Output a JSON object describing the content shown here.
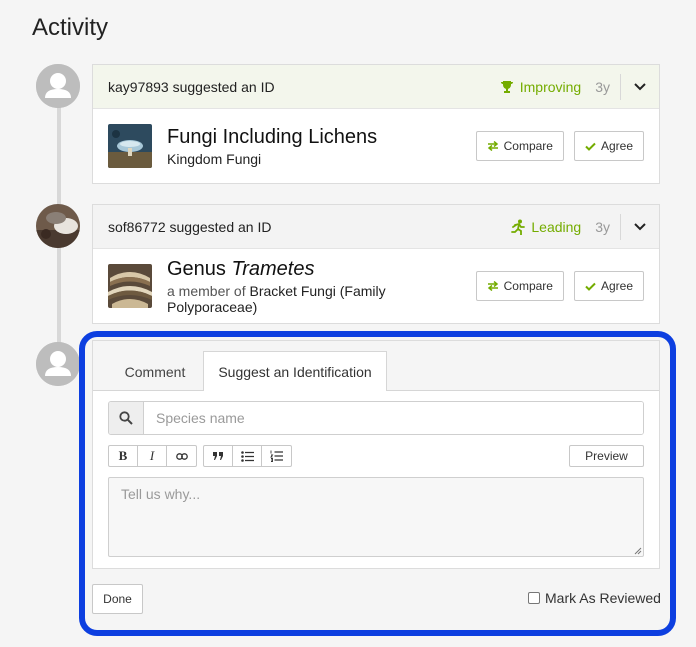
{
  "page": {
    "title": "Activity"
  },
  "identifications": [
    {
      "user": "kay97893",
      "action": " suggested an ID",
      "status": "Improving",
      "status_icon": "trophy-icon",
      "age": "3y",
      "taxon_name": "Fungi Including Lichens",
      "taxon_sub": "Kingdom Fungi",
      "compare_label": "Compare",
      "agree_label": "Agree"
    },
    {
      "user": "sof86772",
      "action": " suggested an ID",
      "status": "Leading",
      "status_icon": "leading-runner-icon",
      "age": "3y",
      "taxon_rank": "Genus ",
      "taxon_genus": "Trametes",
      "taxon_sub_prefix": "a member of ",
      "taxon_sub": "Bracket Fungi (Family Polyporaceae)",
      "compare_label": "Compare",
      "agree_label": "Agree"
    }
  ],
  "form": {
    "tabs": [
      "Comment",
      "Suggest an Identification"
    ],
    "active_tab": "Suggest an Identification",
    "search_placeholder": "Species name",
    "toolbar": {
      "bold": "B",
      "italic": "I"
    },
    "preview_label": "Preview",
    "textarea_placeholder": "Tell us why...",
    "done_label": "Done",
    "mark_reviewed_label": "Mark As Reviewed"
  },
  "colors": {
    "accent_green": "#74ac00",
    "highlight_blue": "#0d3fe0"
  }
}
